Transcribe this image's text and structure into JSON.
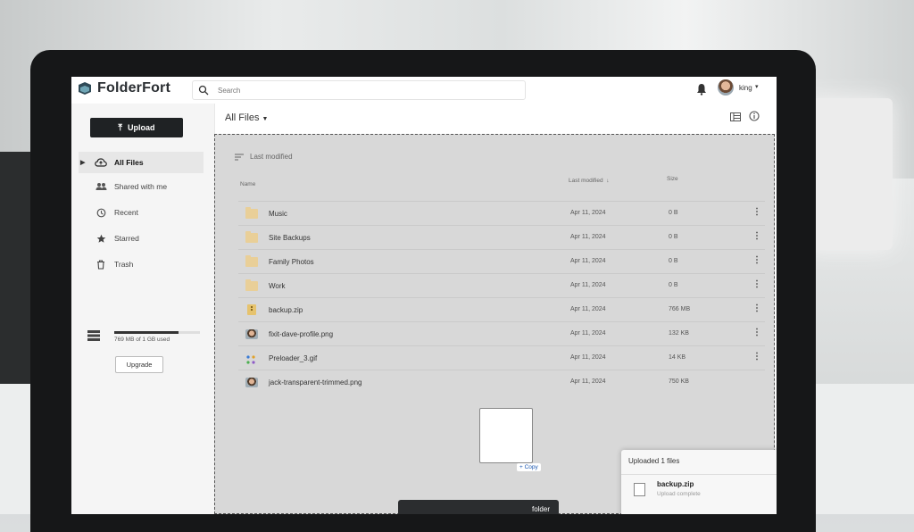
{
  "app": {
    "name_part1": "Folder",
    "name_part2": "Fort",
    "brand_color": "#2b2f33"
  },
  "search": {
    "placeholder": "Search"
  },
  "user": {
    "name": "king"
  },
  "sidebar": {
    "upload_label": "Upload",
    "items": [
      {
        "label": "All Files",
        "icon": "cloud-icon",
        "active": true
      },
      {
        "label": "Shared with me",
        "icon": "people-icon"
      },
      {
        "label": "Recent",
        "icon": "clock-icon"
      },
      {
        "label": "Starred",
        "icon": "star-icon"
      },
      {
        "label": "Trash",
        "icon": "trash-icon"
      }
    ],
    "storage": {
      "text": "769 MB of 1 GB used",
      "used_fraction": 0.75
    },
    "upgrade_label": "Upgrade"
  },
  "main": {
    "title": "All Files",
    "sort_label": "Last modified",
    "columns": {
      "name": "Name",
      "modified": "Last modified",
      "size": "Size"
    },
    "files": [
      {
        "name": "Music",
        "type": "folder",
        "modified": "Apr 11, 2024",
        "size": "0 B"
      },
      {
        "name": "Site Backups",
        "type": "folder",
        "modified": "Apr 11, 2024",
        "size": "0 B"
      },
      {
        "name": "Family Photos",
        "type": "folder",
        "modified": "Apr 11, 2024",
        "size": "0 B"
      },
      {
        "name": "Work",
        "type": "folder",
        "modified": "Apr 11, 2024",
        "size": "0 B"
      },
      {
        "name": "backup.zip",
        "type": "zip",
        "modified": "Apr 11, 2024",
        "size": "766 MB"
      },
      {
        "name": "fixit-dave-profile.png",
        "type": "image",
        "modified": "Apr 11, 2024",
        "size": "132 KB"
      },
      {
        "name": "Preloader_3.gif",
        "type": "gif",
        "modified": "Apr 11, 2024",
        "size": "14 KB"
      },
      {
        "name": "jack-transparent-trimmed.png",
        "type": "image",
        "modified": "Apr 11, 2024",
        "size": "750 KB"
      }
    ],
    "drag_copy_label": "+ Copy"
  },
  "toast": {
    "title": "Uploaded 1 files",
    "file_name": "backup.zip",
    "status": "Upload complete"
  },
  "bottom_bar": {
    "text": "folder"
  }
}
